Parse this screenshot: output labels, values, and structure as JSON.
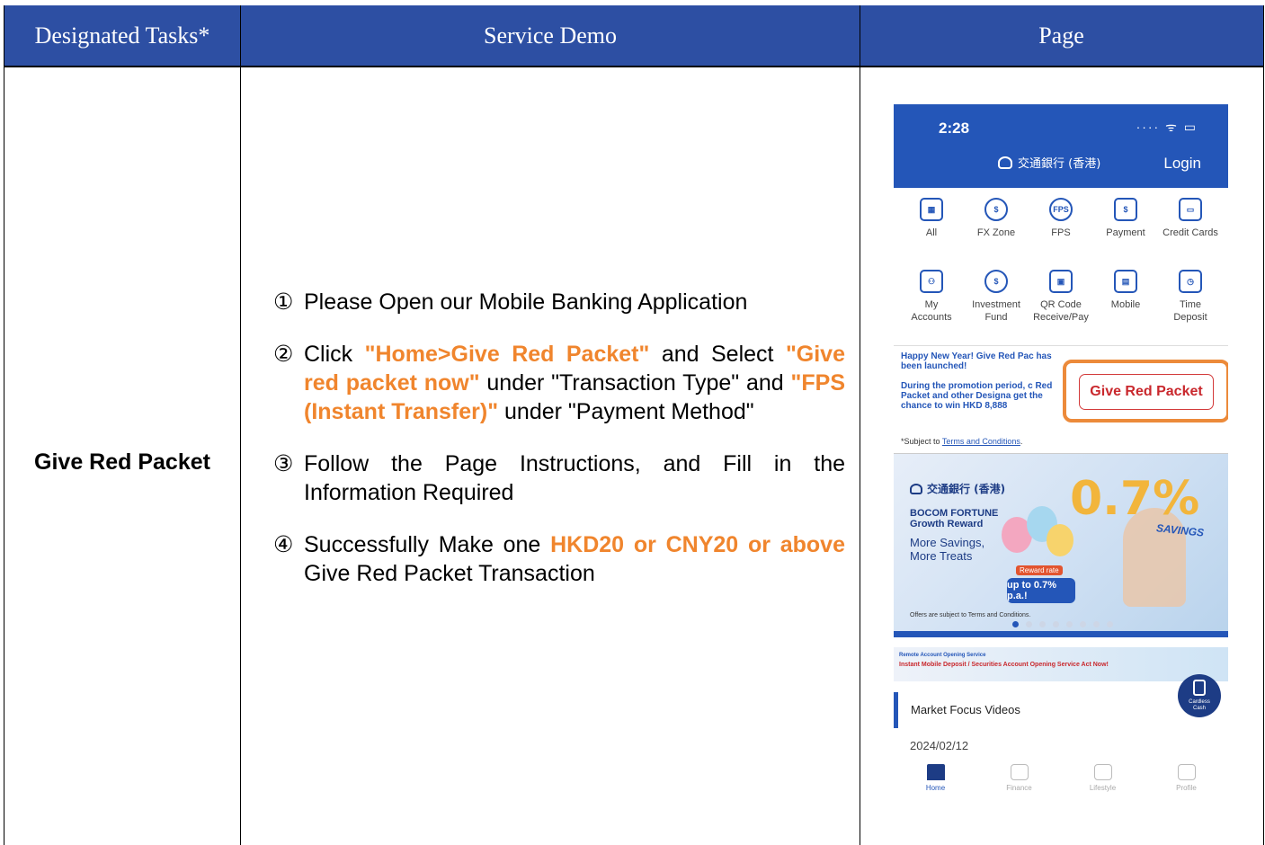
{
  "table": {
    "headers": [
      "Designated Tasks*",
      "Service Demo",
      "Page"
    ],
    "task_name": "Give Red Packet"
  },
  "steps": [
    {
      "num": "①",
      "parts": [
        {
          "t": "Please Open our Mobile Banking Application",
          "h": false
        }
      ]
    },
    {
      "num": "②",
      "parts": [
        {
          "t": "Click ",
          "h": false
        },
        {
          "t": "\"Home>Give Red Packet\"",
          "h": true
        },
        {
          "t": " and Select ",
          "h": false
        },
        {
          "t": "\"Give red packet now\"",
          "h": true
        },
        {
          "t": " under \"Transaction Type\" and ",
          "h": false
        },
        {
          "t": "\"FPS (Instant Transfer)\"",
          "h": true
        },
        {
          "t": " under \"Payment Method\"",
          "h": false
        }
      ]
    },
    {
      "num": "③",
      "parts": [
        {
          "t": "Follow the Page Instructions, and Fill in the Information Required",
          "h": false
        }
      ]
    },
    {
      "num": "④",
      "parts": [
        {
          "t": "Successfully Make one ",
          "h": false
        },
        {
          "t": "HKD20 or CNY20 or above",
          "h": true
        },
        {
          "t": " Give Red Packet Transaction",
          "h": false
        }
      ]
    }
  ],
  "phone": {
    "time": "2:28",
    "status": "···· ᯤ ▭",
    "bank_name": "交通銀行 (香港)",
    "login": "Login",
    "grid_row1": [
      {
        "label": "All",
        "icon": "apps-grid-icon",
        "glyph": "▦"
      },
      {
        "label": "FX Zone",
        "icon": "fx-exchange-icon",
        "glyph": "$"
      },
      {
        "label": "FPS",
        "icon": "fps-icon",
        "glyph": "FPS"
      },
      {
        "label": "Payment",
        "icon": "payment-receipt-icon",
        "glyph": "$"
      },
      {
        "label": "Credit Cards",
        "icon": "credit-card-icon",
        "glyph": "▭"
      }
    ],
    "grid_row2": [
      {
        "label": "My\nAccounts",
        "icon": "accounts-icon",
        "glyph": "⚇"
      },
      {
        "label": "Investment\nFund",
        "icon": "investment-fund-icon",
        "glyph": "$"
      },
      {
        "label": "QR Code\nReceive/Pay",
        "icon": "qr-code-icon",
        "glyph": "▣"
      },
      {
        "label": "Mobile",
        "icon": "mobile-icon",
        "glyph": "▤"
      },
      {
        "label": "Time\nDeposit",
        "icon": "time-deposit-icon",
        "glyph": "◷"
      }
    ],
    "promo_line1": "Happy New Year! Give Red Pac has been launched!",
    "promo_line2": "During the promotion period, c Red Packet and other Designa get the chance to win HKD 8,888",
    "give_red_packet": "Give Red Packet",
    "terms_prefix": "*Subject to ",
    "terms_link": "Terms and Conditions",
    "terms_suffix": ".",
    "banner": {
      "bank_name": "交通銀行 (香港)",
      "title": "BOCOM FORTUNE\nGrowth Reward",
      "subtitle": "More Savings,\nMore Treats",
      "big_rate": "0.7%",
      "savings": "SAVINGS",
      "rate_label": "Reward rate",
      "rate": "up to 0.7% p.a.!",
      "small_print": "Offers are subject to Terms and Conditions.",
      "active_dot": 1,
      "dot_count": 8
    },
    "strip_title": "Remote Account Opening Service",
    "strip_text": "Instant Mobile Deposit / Securities Account Opening Service  Act Now!",
    "cardless": "Cardless\nCash",
    "market_focus": "Market Focus Videos",
    "date": "2024/02/12",
    "tabs": [
      {
        "label": "Home",
        "active": true
      },
      {
        "label": "Finance",
        "active": false
      },
      {
        "label": "Lifestyle",
        "active": false
      },
      {
        "label": "Profile",
        "active": false
      }
    ]
  },
  "colors": {
    "header_bg": "#2d4fa3",
    "highlight": "#f0852d",
    "bank_blue": "#2456b8",
    "red_button": "#c9282d",
    "frame_orange": "#ec8a3a"
  }
}
